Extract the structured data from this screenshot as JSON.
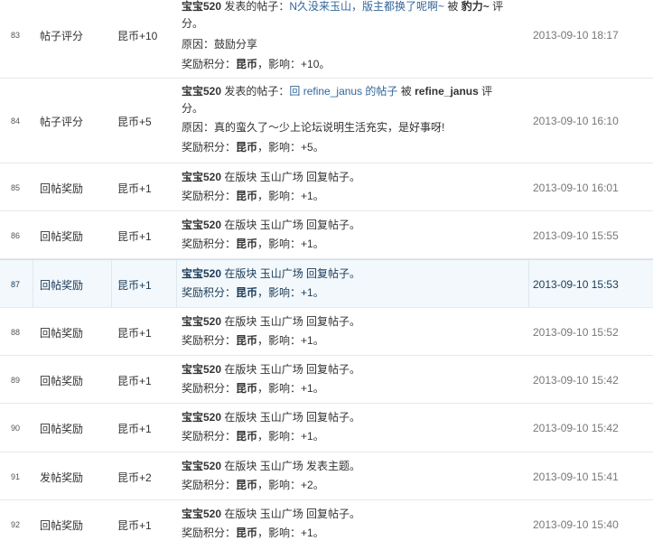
{
  "rows": [
    {
      "num": "83",
      "type": "帖子评分",
      "reward": "昆币+10",
      "line1": {
        "user": "宝宝520",
        "pre": " 发表的帖子：",
        "link": "N久没来玉山，版主都换了呢啊~",
        "mid": " 被 ",
        "rater": "豹力~",
        "post": " 评"
      },
      "line1_wrap": "分。",
      "reason": "原因：鼓励分享",
      "points": {
        "label": "奖励积分：",
        "currency": "昆币",
        "sep": "，影响：",
        "value": "+10",
        "end": "。"
      },
      "time": "2013-09-10 18:17"
    },
    {
      "num": "84",
      "type": "帖子评分",
      "reward": "昆币+5",
      "line1": {
        "user": "宝宝520",
        "pre": " 发表的帖子：",
        "link": "回 refine_janus 的帖子",
        "mid": " 被 ",
        "rater": "refine_janus",
        "post": " 评"
      },
      "line1_wrap": "分。",
      "reason": "原因：真的蛮久了～少上论坛说明生活充实，是好事呀!",
      "points": {
        "label": "奖励积分：",
        "currency": "昆币",
        "sep": "，影响：",
        "value": "+5",
        "end": "。"
      },
      "time": "2013-09-10 16:10"
    },
    {
      "num": "85",
      "type": "回帖奖励",
      "reward": "昆币+1",
      "line1": {
        "user": "宝宝520",
        "text": " 在版块 玉山广场 回复帖子。"
      },
      "points": {
        "label": "奖励积分：",
        "currency": "昆币",
        "sep": "，影响：",
        "value": "+1",
        "end": "。"
      },
      "time": "2013-09-10 16:01"
    },
    {
      "num": "86",
      "type": "回帖奖励",
      "reward": "昆币+1",
      "line1": {
        "user": "宝宝520",
        "text": " 在版块 玉山广场 回复帖子。"
      },
      "points": {
        "label": "奖励积分：",
        "currency": "昆币",
        "sep": "，影响：",
        "value": "+1",
        "end": "。"
      },
      "time": "2013-09-10 15:55"
    },
    {
      "num": "87",
      "type": "回帖奖励",
      "reward": "昆币+1",
      "line1": {
        "user": "宝宝520",
        "text": " 在版块 玉山广场 回复帖子。"
      },
      "points": {
        "label": "奖励积分：",
        "currency": "昆币",
        "sep": "，影响：",
        "value": "+1",
        "end": "。"
      },
      "time": "2013-09-10 15:53"
    },
    {
      "num": "88",
      "type": "回帖奖励",
      "reward": "昆币+1",
      "line1": {
        "user": "宝宝520",
        "text": " 在版块 玉山广场 回复帖子。"
      },
      "points": {
        "label": "奖励积分：",
        "currency": "昆币",
        "sep": "，影响：",
        "value": "+1",
        "end": "。"
      },
      "time": "2013-09-10 15:52"
    },
    {
      "num": "89",
      "type": "回帖奖励",
      "reward": "昆币+1",
      "line1": {
        "user": "宝宝520",
        "text": " 在版块 玉山广场 回复帖子。"
      },
      "points": {
        "label": "奖励积分：",
        "currency": "昆币",
        "sep": "，影响：",
        "value": "+1",
        "end": "。"
      },
      "time": "2013-09-10 15:42"
    },
    {
      "num": "90",
      "type": "回帖奖励",
      "reward": "昆币+1",
      "line1": {
        "user": "宝宝520",
        "text": " 在版块 玉山广场 回复帖子。"
      },
      "points": {
        "label": "奖励积分：",
        "currency": "昆币",
        "sep": "，影响：",
        "value": "+1",
        "end": "。"
      },
      "time": "2013-09-10 15:42"
    },
    {
      "num": "91",
      "type": "发帖奖励",
      "reward": "昆币+2",
      "line1": {
        "user": "宝宝520",
        "text": " 在版块 玉山广场 发表主题。"
      },
      "points": {
        "label": "奖励积分：",
        "currency": "昆币",
        "sep": "，影响：",
        "value": "+2",
        "end": "。"
      },
      "time": "2013-09-10 15:41"
    },
    {
      "num": "92",
      "type": "回帖奖励",
      "reward": "昆币+1",
      "line1": {
        "user": "宝宝520",
        "text": " 在版块 玉山广场 回复帖子。"
      },
      "points": {
        "label": "奖励积分：",
        "currency": "昆币",
        "sep": "，影响：",
        "value": "+1",
        "end": "。"
      },
      "time": "2013-09-10 15:40"
    }
  ]
}
